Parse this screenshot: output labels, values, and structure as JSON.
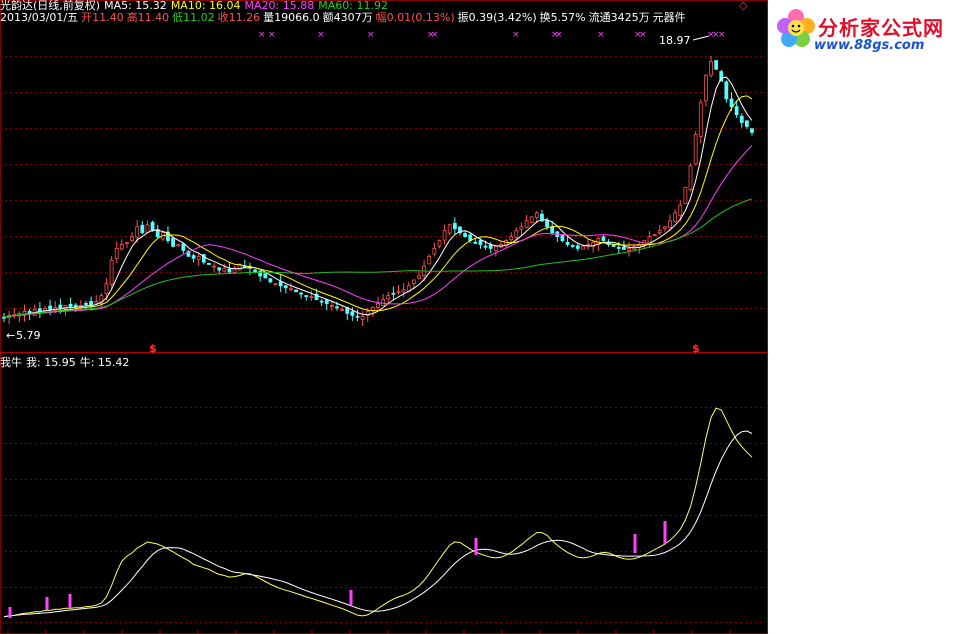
{
  "header": {
    "name": "光韵达(日线,前复权)",
    "ma5": "MA5: 15.32",
    "ma10": "MA10: 16.04",
    "ma20": "MA20: 15.88",
    "ma60": "MA60: 11.92",
    "date": "2013/03/01/五",
    "open_label": "开",
    "open": "11.40",
    "high_label": "高",
    "high": "11.40",
    "low_label": "低",
    "low": "11.02",
    "close_label": "收",
    "close": "11.26",
    "volume": "量19066.0",
    "amount": "额4307万",
    "change": "幅0.01(0.13%)",
    "amplitude": "振0.39(3.42%)",
    "turnover": "换5.57%",
    "float": "流通3425万",
    "sector": "元器件"
  },
  "indicator": {
    "name": "我牛",
    "wo": "我: 15.95",
    "niu": "牛: 15.42"
  },
  "annotations": {
    "max_label": "18.97",
    "min_label": "5.79",
    "signal_mark": "$"
  },
  "logo": {
    "title": "分析家公式网",
    "url": "www.88gs.com"
  },
  "colors": {
    "background": "#000000",
    "grid": "#800000",
    "up": "#ff5050",
    "down": "#54ffff",
    "ma5": "#ffffff",
    "ma10": "#ffff00",
    "ma20": "#ff40ff",
    "ma60": "#20c020",
    "signal": "#ff40ff"
  },
  "chart_data": [
    {
      "type": "candlestick",
      "title": "光韵达(日线,前复权)",
      "ylim": [
        5.0,
        20.5
      ],
      "close": [
        5.9,
        6.0,
        6.05,
        6.1,
        6.2,
        6.1,
        6.3,
        6.2,
        6.35,
        6.3,
        6.4,
        6.35,
        6.5,
        6.4,
        6.45,
        6.5,
        6.6,
        6.5,
        6.7,
        7.0,
        7.6,
        8.8,
        9.4,
        9.6,
        9.7,
        10.0,
        10.5,
        10.2,
        10.6,
        10.3,
        10.0,
        10.2,
        9.8,
        9.5,
        9.6,
        9.3,
        9.0,
        8.9,
        9.0,
        8.7,
        8.6,
        8.5,
        8.3,
        8.4,
        8.2,
        8.4,
        8.6,
        8.5,
        8.4,
        8.2,
        8.0,
        7.9,
        7.7,
        7.6,
        7.5,
        7.4,
        7.35,
        7.2,
        7.1,
        7.0,
        6.95,
        6.8,
        6.7,
        6.6,
        6.5,
        6.4,
        6.3,
        6.1,
        6.0,
        5.9,
        5.95,
        6.2,
        6.4,
        6.6,
        6.8,
        7.0,
        7.1,
        7.2,
        7.3,
        7.5,
        7.8,
        8.0,
        8.5,
        9.0,
        9.4,
        9.8,
        10.3,
        10.6,
        10.4,
        10.2,
        10.0,
        9.8,
        9.7,
        9.6,
        9.5,
        9.4,
        9.5,
        9.6,
        9.8,
        10.0,
        10.3,
        10.5,
        10.8,
        11.0,
        11.2,
        10.8,
        10.5,
        10.2,
        10.0,
        9.8,
        9.6,
        9.5,
        9.4,
        9.5,
        9.6,
        9.7,
        9.9,
        9.8,
        9.6,
        9.5,
        9.4,
        9.35,
        9.4,
        9.5,
        9.6,
        9.8,
        10.0,
        10.1,
        10.3,
        10.5,
        10.8,
        11.2,
        11.6,
        12.5,
        13.6,
        15.2,
        16.8,
        18.2,
        18.9,
        18.5,
        17.9,
        17.0,
        16.6,
        16.2,
        15.8,
        15.6,
        15.3
      ],
      "ma60_end": 11.92,
      "max": {
        "value": 18.97,
        "label": "18.97"
      },
      "min": {
        "value": 5.79,
        "label": "5.79"
      },
      "signal_marks": [
        "$",
        "$"
      ]
    },
    {
      "type": "line",
      "title": "我牛",
      "series": [
        {
          "name": "我",
          "last": 15.95
        },
        {
          "name": "牛",
          "last": 15.42
        }
      ]
    }
  ]
}
